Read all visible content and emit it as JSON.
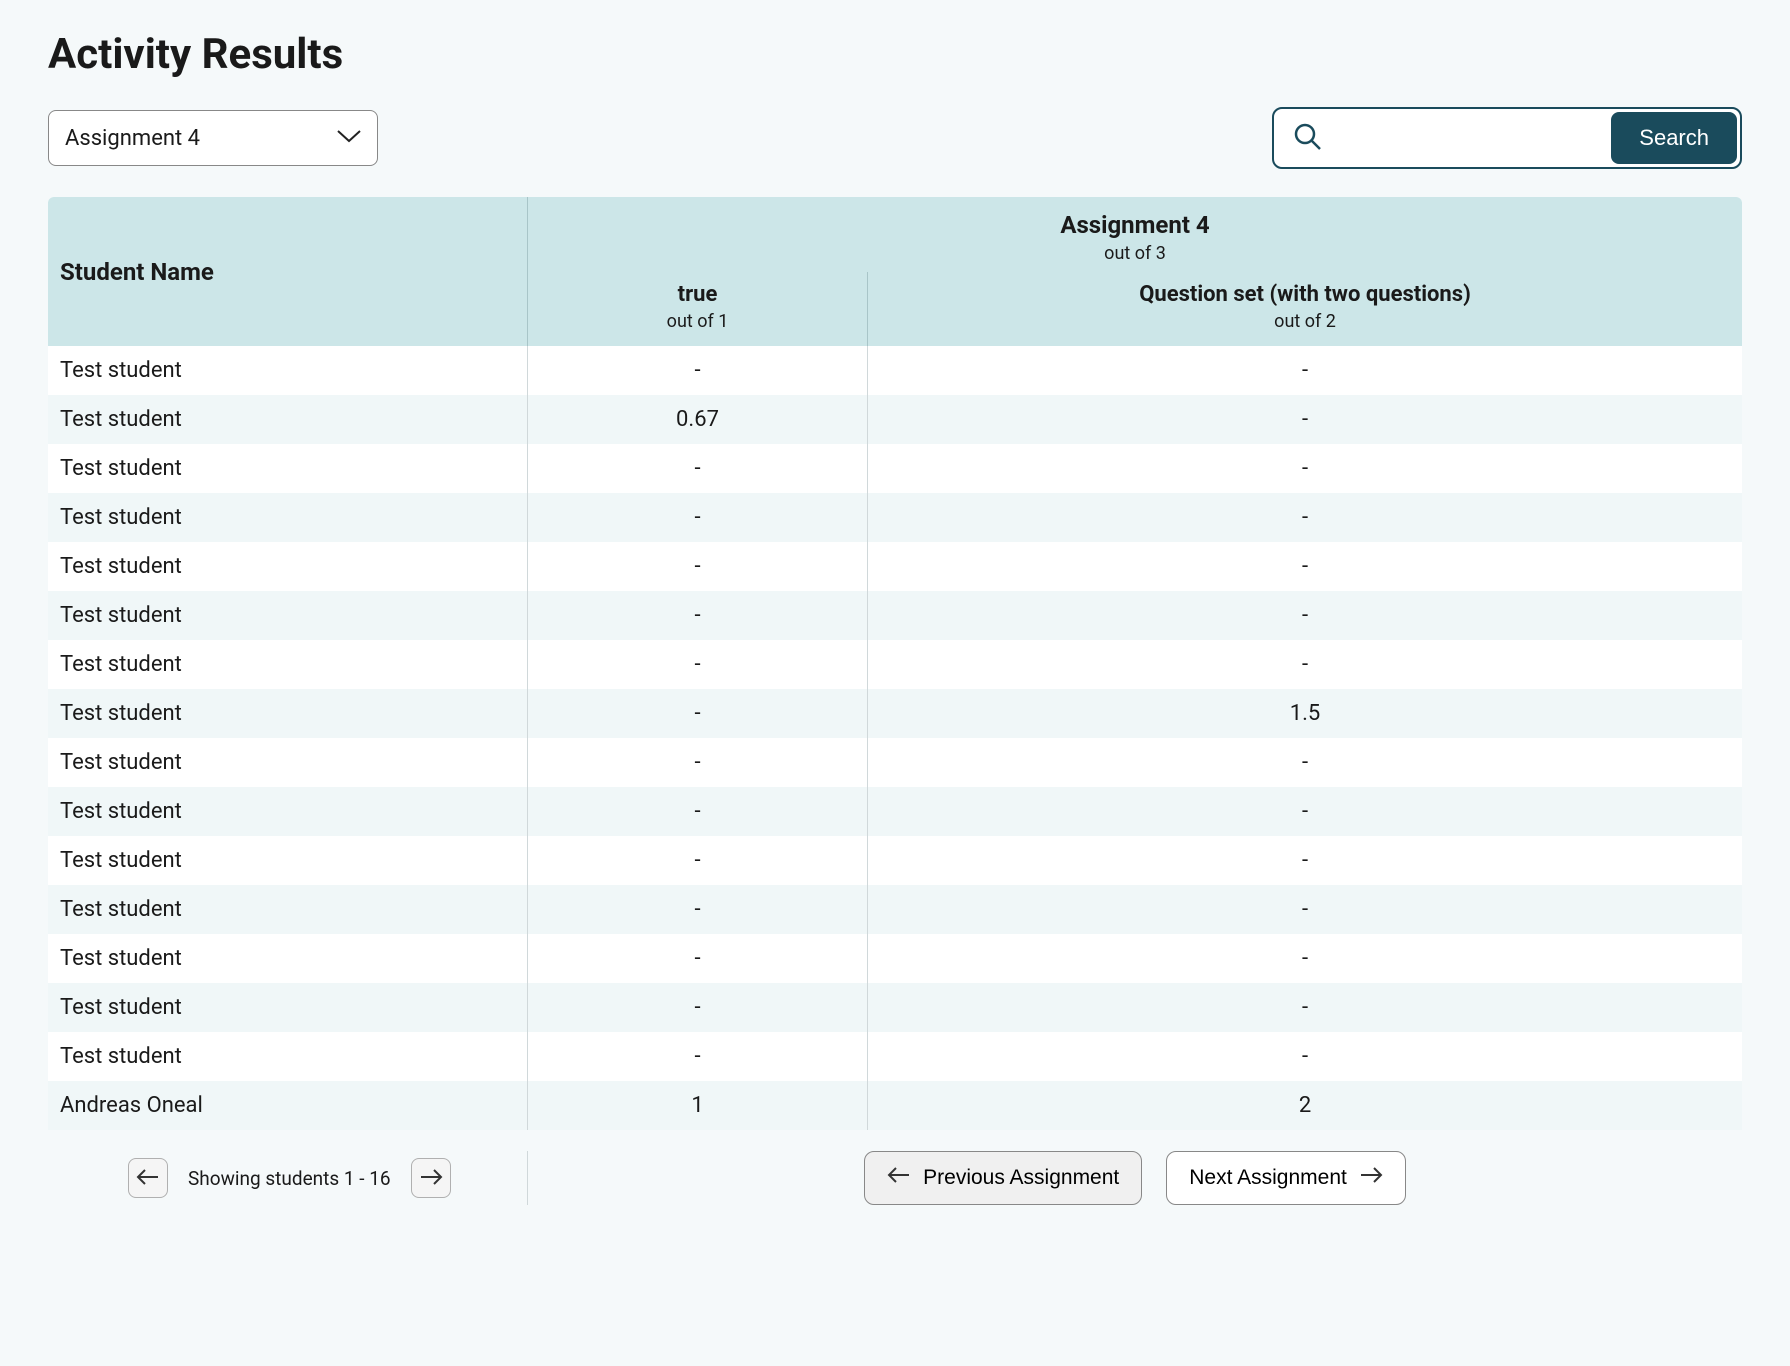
{
  "page_title": "Activity Results",
  "assignment_selector_value": "Assignment 4",
  "search": {
    "value": "",
    "button_label": "Search"
  },
  "table": {
    "student_name_header": "Student Name",
    "group": {
      "title": "Assignment 4",
      "subtitle": "out of 3"
    },
    "columns": [
      {
        "title": "true",
        "subtitle": "out of 1"
      },
      {
        "title": "Question set (with two questions)",
        "subtitle": "out of 2"
      }
    ],
    "rows": [
      {
        "name": "Test student",
        "c1": "-",
        "c2": "-"
      },
      {
        "name": "Test student",
        "c1": "0.67",
        "c2": "-"
      },
      {
        "name": "Test student",
        "c1": "-",
        "c2": "-"
      },
      {
        "name": "Test student",
        "c1": "-",
        "c2": "-"
      },
      {
        "name": "Test student",
        "c1": "-",
        "c2": "-"
      },
      {
        "name": "Test student",
        "c1": "-",
        "c2": "-"
      },
      {
        "name": "Test student",
        "c1": "-",
        "c2": "-"
      },
      {
        "name": "Test student",
        "c1": "-",
        "c2": "1.5"
      },
      {
        "name": "Test student",
        "c1": "-",
        "c2": "-"
      },
      {
        "name": "Test student",
        "c1": "-",
        "c2": "-"
      },
      {
        "name": "Test student",
        "c1": "-",
        "c2": "-"
      },
      {
        "name": "Test student",
        "c1": "-",
        "c2": "-"
      },
      {
        "name": "Test student",
        "c1": "-",
        "c2": "-"
      },
      {
        "name": "Test student",
        "c1": "-",
        "c2": "-"
      },
      {
        "name": "Test student",
        "c1": "-",
        "c2": "-"
      },
      {
        "name": "Andreas Oneal",
        "c1": "1",
        "c2": "2"
      }
    ]
  },
  "pager": {
    "status": "Showing students 1 - 16"
  },
  "nav": {
    "previous_label": "Previous Assignment",
    "next_label": "Next Assignment"
  }
}
